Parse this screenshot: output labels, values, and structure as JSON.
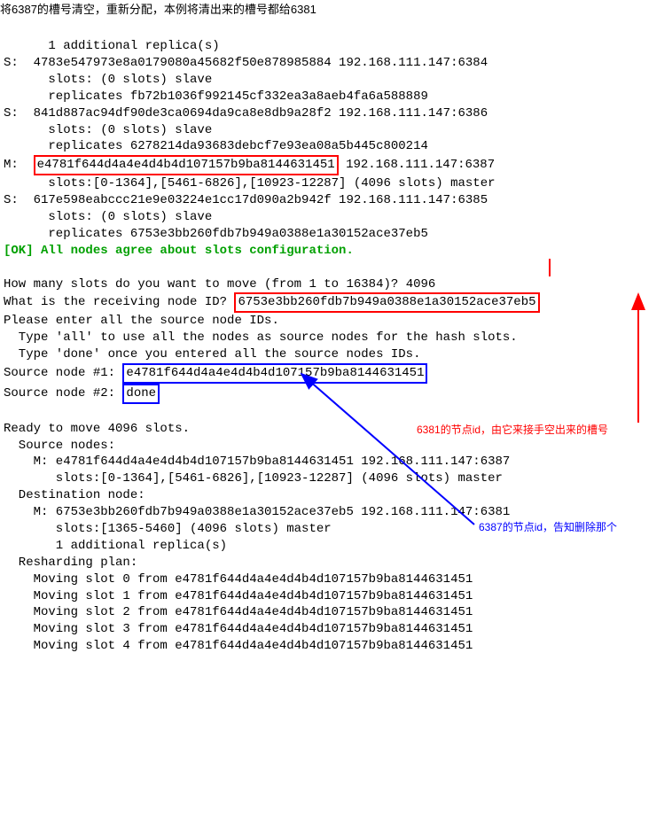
{
  "header": {
    "title_cn": "将6387的槽号清空，重新分配，本例将清出来的槽号都给6381"
  },
  "preamble": {
    "additional": "      1 additional replica(s)",
    "l1": "S:  4783e547973e8a0179080a45682f50e878985884 192.168.111.147:6384",
    "l2": "      slots: (0 slots) slave",
    "l3": "      replicates fb72b1036f992145cf332ea3a8aeb4fa6a588889",
    "l4": "S:  841d887ac94df90de3ca0694da9ca8e8db9a28f2 192.168.111.147:6386",
    "l5": "      slots: (0 slots) slave",
    "l6": "      replicates 6278214da93683debcf7e93ea08a5b445c800214",
    "m_prefix": "M:  ",
    "m_id": "e4781f644d4a4e4d4b4d107157b9ba8144631451",
    "m_suffix": " 192.168.111.147:6387",
    "m_slots": "      slots:[0-1364],[5461-6826],[10923-12287] (4096 slots) master",
    "l7": "S:  617e598eabccc21e9e03224e1cc17d090a2b942f 192.168.111.147:6385",
    "l8": "      slots: (0 slots) slave",
    "l9": "      replicates 6753e3bb260fdb7b949a0388e1a30152ace37eb5",
    "ok": "[OK] All nodes agree about slots configuration."
  },
  "prompts": {
    "slots_q": "How many slots do you want to move (from 1 to 16384)? ",
    "slots_a": "4096",
    "recv_q": "What is the receiving node ID? ",
    "recv_a": "6753e3bb260fdb7b949a0388e1a30152ace37eb5",
    "src_intro": "Please enter all the source node IDs.",
    "src_hint1": "  Type 'all' to use all the nodes as source nodes for the hash slots.",
    "src_hint2": "  Type 'done' once you entered all the source nodes IDs.",
    "src1_label": "Source node #1: ",
    "src1_val": "e4781f644d4a4e4d4b4d107157b9ba8144631451",
    "src2_label": "Source node #2: ",
    "src2_val": "done"
  },
  "ready": {
    "title": "Ready to move 4096 slots.",
    "src_hdr": "  Source nodes:",
    "src_m": "    M: e4781f644d4a4e4d4b4d107157b9ba8144631451 192.168.111.147:6387",
    "src_slots": "       slots:[0-1364],[5461-6826],[10923-12287] (4096 slots) master",
    "dst_hdr": "  Destination node:",
    "dst_m": "    M: 6753e3bb260fdb7b949a0388e1a30152ace37eb5 192.168.111.147:6381",
    "dst_slots": "       slots:[1365-5460] (4096 slots) master",
    "dst_add": "       1 additional replica(s)",
    "plan": "  Resharding plan:",
    "mv0": "    Moving slot 0 from e4781f644d4a4e4d4b4d107157b9ba8144631451",
    "mv1": "    Moving slot 1 from e4781f644d4a4e4d4b4d107157b9ba8144631451",
    "mv2": "    Moving slot 2 from e4781f644d4a4e4d4b4d107157b9ba8144631451",
    "mv3": "    Moving slot 3 from e4781f644d4a4e4d4b4d107157b9ba8144631451",
    "mv4": "    Moving slot 4 from e4781f644d4a4e4d4b4d107157b9ba8144631451"
  },
  "annotations": {
    "a6381": "6381的节点id，由它来接手空出来的槽号",
    "a6387": "6387的节点id，告知删除那个"
  }
}
